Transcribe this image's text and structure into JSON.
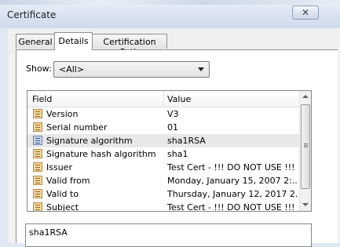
{
  "window": {
    "title": "Certificate",
    "close_label": "✕"
  },
  "tabs": [
    {
      "label": "General"
    },
    {
      "label": "Details"
    },
    {
      "label": "Certification Path"
    }
  ],
  "show": {
    "label": "Show:",
    "selected": "<All>"
  },
  "list": {
    "headers": {
      "field": "Field",
      "value": "Value"
    },
    "rows": [
      {
        "field": "Version",
        "value": "V3"
      },
      {
        "field": "Serial number",
        "value": "01"
      },
      {
        "field": "Signature algorithm",
        "value": "sha1RSA"
      },
      {
        "field": "Signature hash algorithm",
        "value": "sha1"
      },
      {
        "field": "Issuer",
        "value": "Test Cert - !!! DO NOT USE !!!"
      },
      {
        "field": "Valid from",
        "value": "Monday, January 15, 2007 2:..."
      },
      {
        "field": "Valid to",
        "value": "Thursday, January 12, 2017 2..."
      },
      {
        "field": "Subject",
        "value": "Test Cert - !!! DO NOT USE !!!"
      }
    ]
  },
  "detail": {
    "text": "sha1RSA"
  },
  "icons": {
    "row_icon": "certificate-field-icon",
    "close": "close-icon",
    "dropdown": "chevron-down-icon"
  }
}
